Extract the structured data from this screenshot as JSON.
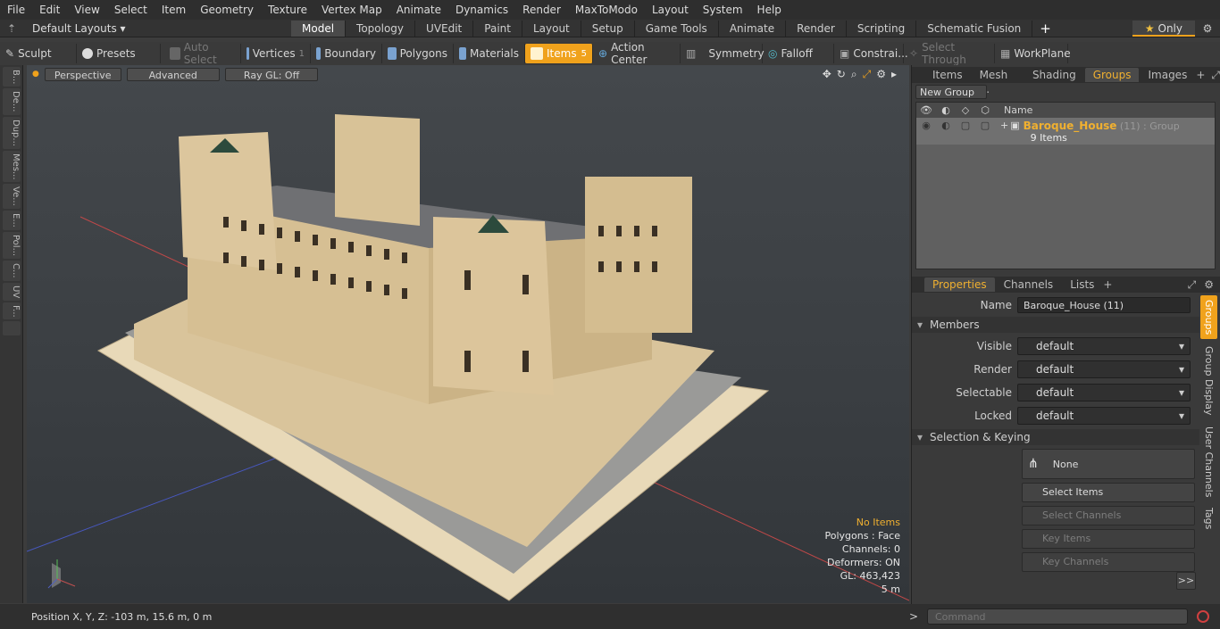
{
  "menu": [
    "File",
    "Edit",
    "View",
    "Select",
    "Item",
    "Geometry",
    "Texture",
    "Vertex Map",
    "Animate",
    "Dynamics",
    "Render",
    "MaxToModo",
    "Layout",
    "System",
    "Help"
  ],
  "layout": {
    "label": "Default Layouts"
  },
  "tabs": [
    "Model",
    "Topology",
    "UVEdit",
    "Paint",
    "Layout",
    "Setup",
    "Game Tools",
    "Animate",
    "Render",
    "Scripting",
    "Schematic Fusion"
  ],
  "only_label": "Only",
  "toolbar": {
    "sculpt": "Sculpt",
    "presets": "Presets",
    "auto_select": "Auto Select",
    "vertices": "Vertices",
    "vertices_count": "1",
    "boundary": "Boundary",
    "polygons": "Polygons",
    "materials": "Materials",
    "items": "Items",
    "items_count": "5",
    "action_center": "Action Center",
    "symmetry": "Symmetry",
    "falloff": "Falloff",
    "constraints": "Constrai...",
    "select_through": "Select Through",
    "workplane": "WorkPlane"
  },
  "left_tabs": [
    "B...",
    "De...",
    "Dup...",
    "Mes...",
    "Ve...",
    "E...",
    "Pol...",
    "C...",
    "UV",
    "F..."
  ],
  "viewport": {
    "perspective": "Perspective",
    "advanced": "Advanced",
    "raygl": "Ray GL: Off",
    "info": {
      "no_items": "No Items",
      "polygons": "Polygons : Face",
      "channels": "Channels: 0",
      "deformers": "Deformers: ON",
      "gl": "GL: 463,423",
      "scale": "5 m"
    }
  },
  "status": {
    "position": "Position X, Y, Z:  -103 m, 15.6 m, 0 m"
  },
  "top_panel": {
    "tabs": [
      "Items",
      "Mesh ...",
      "Shading",
      "Groups",
      "Images"
    ],
    "new_group": "New Group",
    "name_header": "Name",
    "group": {
      "name": "Baroque_House",
      "count": "(11)",
      "type": ": Group",
      "sub": "9 Items"
    }
  },
  "props": {
    "tabs": [
      "Properties",
      "Channels",
      "Lists"
    ],
    "name_label": "Name",
    "name_value": "Baroque_House (11)",
    "members": "Members",
    "visible": {
      "label": "Visible",
      "value": "default"
    },
    "render": {
      "label": "Render",
      "value": "default"
    },
    "selectable": {
      "label": "Selectable",
      "value": "default"
    },
    "locked": {
      "label": "Locked",
      "value": "default"
    },
    "sel_keying": "Selection & Keying",
    "none": "None",
    "select_items": "Select Items",
    "select_channels": "Select Channels",
    "key_items": "Key Items",
    "key_channels": "Key Channels",
    "more": ">>",
    "side_tabs": [
      "Groups",
      "Group Display",
      "User Channels",
      "Tags"
    ]
  },
  "command_placeholder": "Command"
}
